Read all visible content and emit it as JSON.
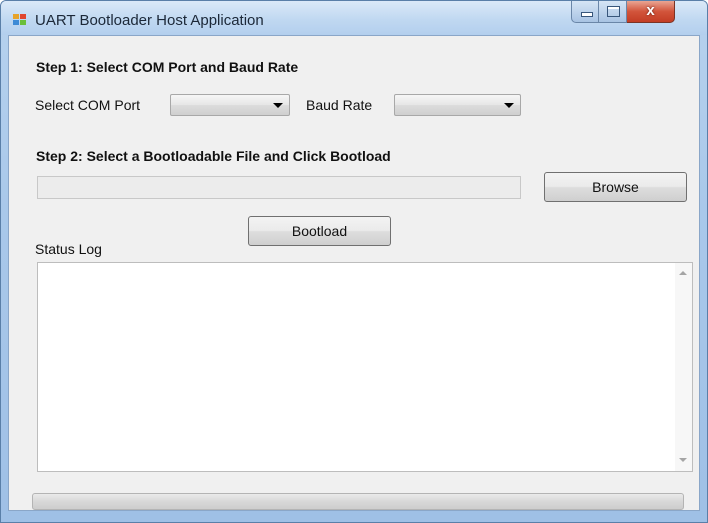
{
  "window": {
    "title": "UART Bootloader Host Application",
    "close_glyph": "x"
  },
  "step1": {
    "heading": "Step 1: Select COM Port and Baud Rate",
    "com_port_label": "Select COM Port",
    "com_port_value": "",
    "baud_rate_label": "Baud Rate",
    "baud_rate_value": ""
  },
  "step2": {
    "heading": "Step 2: Select a Bootloadable File and Click Bootload",
    "file_path": "",
    "browse_label": "Browse",
    "bootload_label": "Bootload"
  },
  "status": {
    "log_label": "Status Log",
    "log_text": "",
    "progress": 0
  },
  "icons": {
    "app": "app-window-icon",
    "minimize": "minimize-icon",
    "maximize": "maximize-icon",
    "close": "close-icon",
    "dropdown": "chevron-down-icon",
    "scroll_up": "scroll-up-icon",
    "scroll_down": "scroll-down-icon"
  },
  "colors": {
    "title_bar": "#c0d8f1",
    "close_button": "#c94a31",
    "client_background": "#f0f0f0"
  }
}
